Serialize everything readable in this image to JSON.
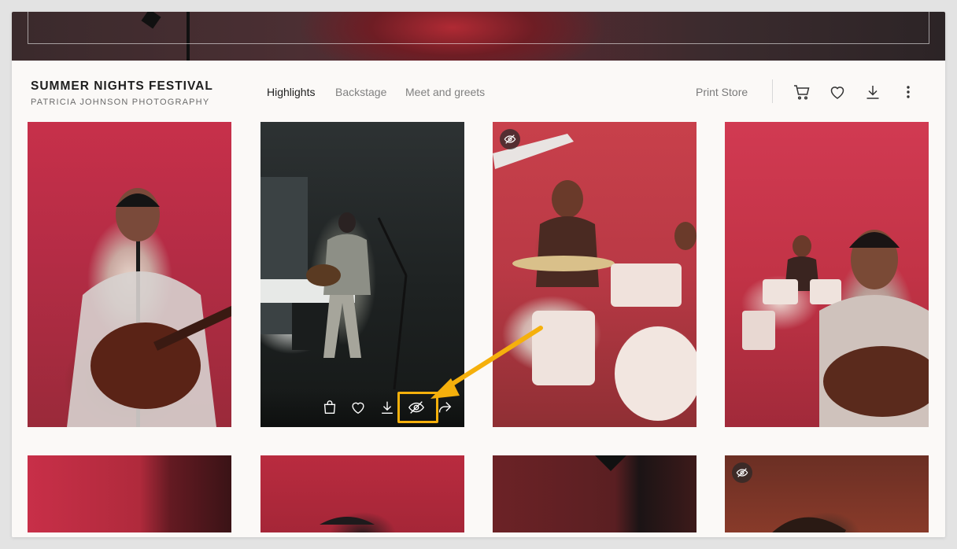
{
  "gallery": {
    "title": "SUMMER NIGHTS FESTIVAL",
    "subtitle": "PATRICIA JOHNSON PHOTOGRAPHY"
  },
  "tabs": [
    {
      "label": "Highlights",
      "active": true
    },
    {
      "label": "Backstage",
      "active": false
    },
    {
      "label": "Meet and greets",
      "active": false
    }
  ],
  "header_actions": {
    "print_store": "Print Store",
    "icons": [
      "cart-icon",
      "heart-icon",
      "download-icon",
      "more-vertical-icon"
    ]
  },
  "photos": [
    {
      "row": 1,
      "col": 1,
      "subject": "singer with guitar at microphone",
      "hidden": false
    },
    {
      "row": 1,
      "col": 2,
      "subject": "guitarist on dark stage",
      "hidden": false,
      "hovered": true
    },
    {
      "row": 1,
      "col": 3,
      "subject": "drummer at drum kit",
      "hidden": true
    },
    {
      "row": 1,
      "col": 4,
      "subject": "singer with guitar and drummer",
      "hidden": false
    },
    {
      "row": 2,
      "col": 1,
      "subject": "red stage",
      "hidden": false
    },
    {
      "row": 2,
      "col": 2,
      "subject": "performer in cap",
      "hidden": false
    },
    {
      "row": 2,
      "col": 3,
      "subject": "dark red stage",
      "hidden": false
    },
    {
      "row": 2,
      "col": 4,
      "subject": "performer in cap",
      "hidden": true
    }
  ],
  "photo_actions": [
    "shopping-bag-icon",
    "heart-icon",
    "download-icon",
    "eye-off-icon",
    "share-icon"
  ],
  "annotation": {
    "color": "#f5b00c",
    "highlights": "eye-off-icon"
  },
  "colors": {
    "background": "#fbf9f7",
    "accent": "#f5b00c",
    "text": "#1e1e1e",
    "muted": "#808080"
  }
}
